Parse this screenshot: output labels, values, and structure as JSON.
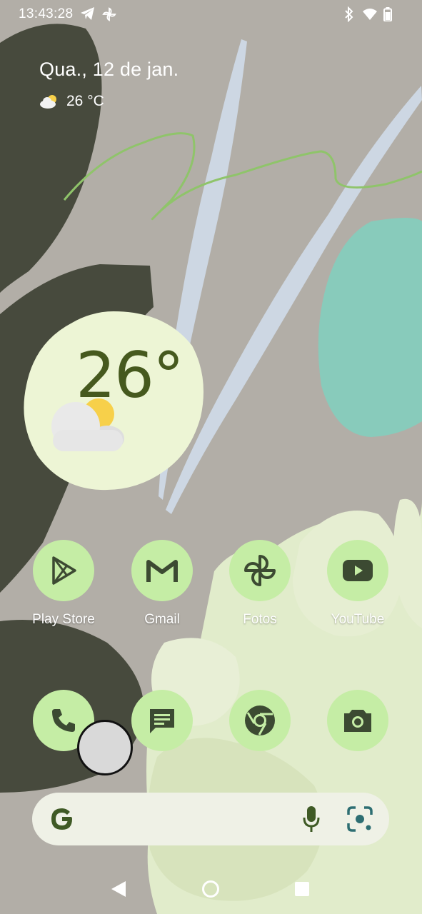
{
  "status_bar": {
    "time": "13:43:28",
    "left_icons": [
      "telegram-icon",
      "pinwheel-icon"
    ],
    "right_icons": [
      "bluetooth-icon",
      "wifi-icon",
      "battery-icon"
    ]
  },
  "at_a_glance": {
    "date": "Qua., 12 de jan.",
    "temperature": "26 °C",
    "weather_icon": "partly-sunny-icon"
  },
  "weather_widget": {
    "temperature": "26°",
    "icon": "partly-sunny-icon"
  },
  "apps_row1": [
    {
      "label": "Play Store",
      "icon": "play-store-icon"
    },
    {
      "label": "Gmail",
      "icon": "gmail-icon"
    },
    {
      "label": "Fotos",
      "icon": "photos-pinwheel-icon"
    },
    {
      "label": "YouTube",
      "icon": "youtube-icon"
    }
  ],
  "dock": [
    {
      "icon": "phone-icon"
    },
    {
      "icon": "messages-icon"
    },
    {
      "icon": "chrome-icon"
    },
    {
      "icon": "camera-icon"
    }
  ],
  "search_bar": {
    "icons": [
      "google-g-icon",
      "microphone-icon",
      "google-lens-icon"
    ]
  },
  "nav_bar": {
    "icons": [
      "back-icon",
      "home-icon",
      "recents-icon"
    ]
  },
  "colors": {
    "app_circle": "#c5eda5",
    "app_glyph": "#3c4a32",
    "weather_widget_bg": "#edf5d5",
    "weather_text": "#46591e",
    "search_bar_bg": "#eff1e6",
    "wallpaper_base": "#b2aea7"
  }
}
